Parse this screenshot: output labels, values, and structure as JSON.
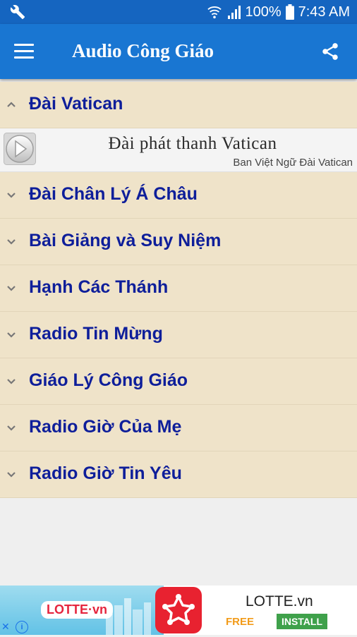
{
  "status_bar": {
    "battery": "100%",
    "time": "7:43 AM",
    "icons": [
      "wrench-icon",
      "wifi-icon",
      "signal-icon",
      "battery-icon"
    ]
  },
  "app_bar": {
    "title": "Audio Công Giáo",
    "icons": [
      "menu-icon",
      "share-icon"
    ]
  },
  "colors": {
    "status_bar": "#1565c0",
    "app_bar": "#1976d2",
    "category_bg": "#efe3c9",
    "category_text": "#0e1e9a",
    "page_bg": "#efefef"
  },
  "categories": [
    {
      "label": "Đài Vatican",
      "expanded": true,
      "children": [
        {
          "name": "Đài phát thanh Vatican",
          "subtitle": "Ban Việt Ngữ Đài Vatican"
        }
      ]
    },
    {
      "label": "Đài Chân Lý Á Châu",
      "expanded": false
    },
    {
      "label": "Bài Giảng và Suy Niệm",
      "expanded": false
    },
    {
      "label": "Hạnh Các Thánh",
      "expanded": false
    },
    {
      "label": "Radio Tin Mừng",
      "expanded": false
    },
    {
      "label": "Giáo Lý Công Giáo",
      "expanded": false
    },
    {
      "label": "Radio Giờ Của Mẹ",
      "expanded": false
    },
    {
      "label": "Radio Giờ Tin Yêu",
      "expanded": false
    }
  ],
  "ad": {
    "banner_logo": "LOTTE·vn",
    "app_name": "LOTTE.vn",
    "price": "FREE",
    "install_label": "INSTALL"
  }
}
